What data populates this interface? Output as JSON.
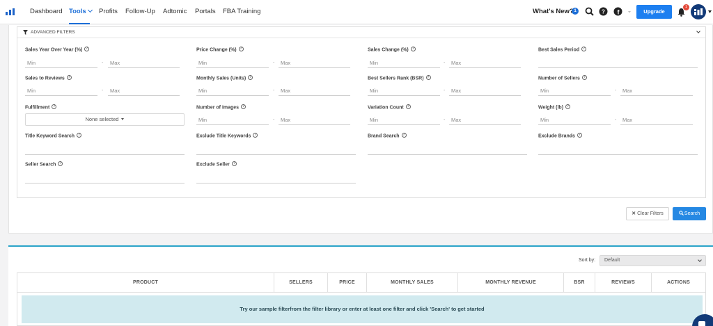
{
  "nav": {
    "items": [
      "Dashboard",
      "Tools",
      "Profits",
      "Follow-Up",
      "Adtomic",
      "Portals",
      "FBA Training"
    ],
    "whats_new": "What's New?",
    "whats_new_count": "1",
    "upgrade": "Upgrade",
    "notifications": "1"
  },
  "filters": {
    "title": "ADVANCED FILTERS",
    "min": "Min",
    "max": "Max",
    "dash": "-",
    "labels": {
      "sales_yoy": "Sales Year Over Year (%)",
      "price_change": "Price Change (%)",
      "sales_change": "Sales Change (%)",
      "best_sales_period": "Best Sales Period",
      "sales_to_reviews": "Sales to Reviews",
      "monthly_sales": "Monthly Sales (Units)",
      "bsr": "Best Sellers Rank (BSR)",
      "num_sellers": "Number of Sellers",
      "fulfillment": "Fulfillment",
      "num_images": "Number of Images",
      "variation_count": "Variation Count",
      "weight": "Weight (lb)",
      "title_keyword": "Title Keyword Search",
      "exclude_title": "Exclude Title Keywords",
      "brand_search": "Brand Search",
      "exclude_brands": "Exclude Brands",
      "seller_search": "Seller Search",
      "exclude_seller": "Exclude Seller"
    },
    "fulfillment_value": "None selected",
    "clear": "Clear Filters",
    "search": "Search"
  },
  "results": {
    "sort_label": "Sort by:",
    "sort_value": "Default",
    "columns": [
      "PRODUCT",
      "SELLERS",
      "PRICE",
      "MONTHLY SALES",
      "MONTHLY REVENUE",
      "BSR",
      "REVIEWS",
      "ACTIONS"
    ],
    "empty_message": "Try our sample filterfrom the filter library or enter at least one filter and click 'Search' to get started"
  }
}
